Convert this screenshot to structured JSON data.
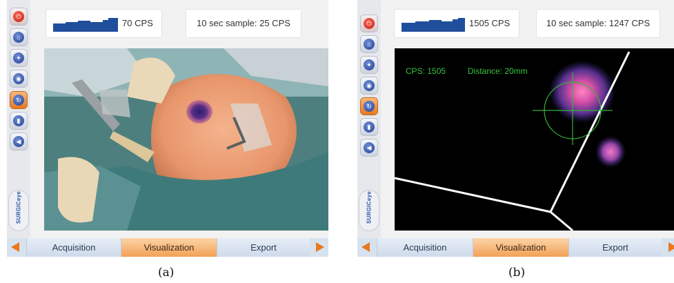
{
  "colors": {
    "accent_orange": "#e9781f",
    "bar_blue": "#1f4e9c",
    "overlay_green": "#38c43c"
  },
  "icons": {
    "sidebar": [
      "power-icon",
      "home-icon",
      "capture-icon",
      "camera-icon",
      "visualization-icon",
      "probe-icon",
      "volume-icon"
    ],
    "nav": [
      "arrow-left-icon",
      "arrow-right-icon"
    ]
  },
  "panel_a": {
    "cps": "70 CPS",
    "sample": "10 sec sample: 25 CPS",
    "logo": "SURGICeye",
    "tabs": [
      "Acquisition",
      "Visualization",
      "Export"
    ],
    "active_tab": "Visualization",
    "caption": "(a)"
  },
  "panel_b": {
    "cps": "1505 CPS",
    "sample": "10 sec sample: 1247 CPS",
    "overlay_cps": "CPS: 1505",
    "overlay_distance": "Distance: 20mm",
    "logo": "SURGICeye",
    "tabs": [
      "Acquisition",
      "Visualization",
      "Export"
    ],
    "active_tab": "Visualization",
    "caption": "(b)"
  }
}
